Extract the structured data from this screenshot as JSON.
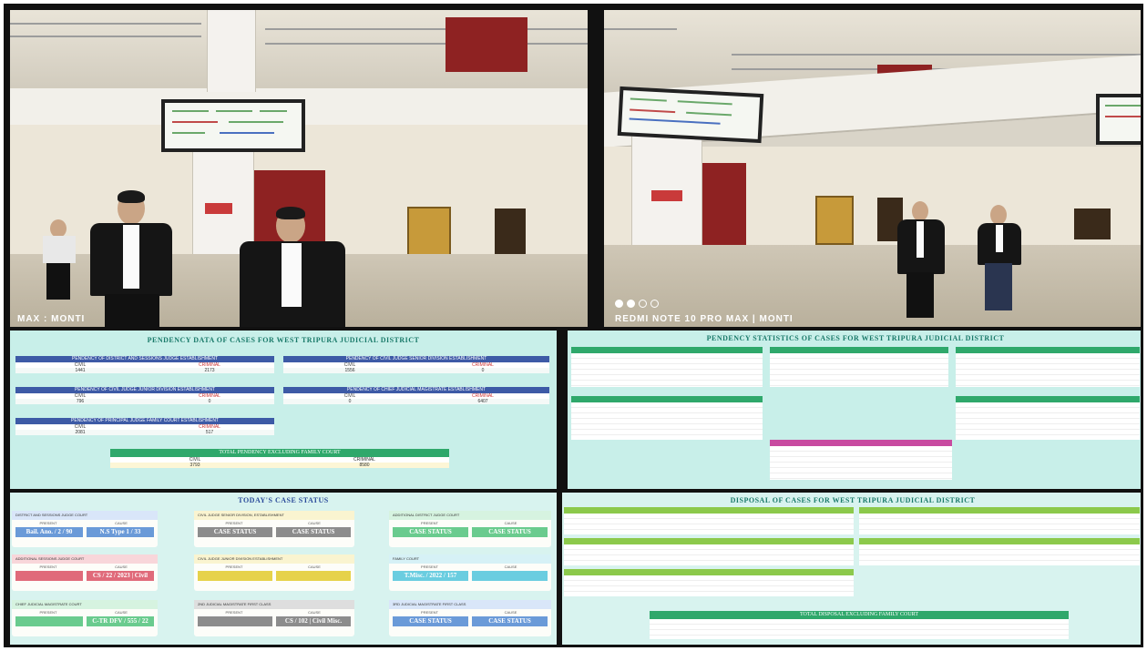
{
  "photos": {
    "left_watermark": "MAX : MONTI",
    "right_watermark": "REDMI NOTE 10 PRO MAX | MONTI"
  },
  "pendency_data": {
    "title": "PENDENCY DATA OF CASES FOR WEST TRIPURA JUDICIAL DISTRICT",
    "boxes": [
      {
        "header": "PENDENCY OF DISTRICT AND SESSIONS JUDGE ESTABLISHMENT",
        "cols": [
          "CIVIL",
          "CRIMINAL"
        ],
        "values": [
          "1441",
          "2173"
        ]
      },
      {
        "header": "PENDENCY OF CIVIL JUDGE SENIOR DIVISION ESTABLISHMENT",
        "cols": [
          "CIVIL",
          "CRIMINAL"
        ],
        "values": [
          "1556",
          "0"
        ]
      },
      {
        "header": "PENDENCY OF CIVIL JUDGE JUNIOR DIVISION ESTABLISHMENT",
        "cols": [
          "CIVIL",
          "CRIMINAL"
        ],
        "values": [
          "796",
          "0"
        ]
      },
      {
        "header": "PENDENCY OF CHIEF JUDICIAL MAGISTRATE ESTABLISHMENT",
        "cols": [
          "CIVIL",
          "CRIMINAL"
        ],
        "values": [
          "0",
          "6407"
        ]
      },
      {
        "header": "PENDENCY OF PRINCIPAL JUDGE FAMILY COURT ESTABLISHMENT",
        "cols": [
          "CIVIL",
          "CRIMINAL"
        ],
        "values": [
          "2081",
          "517"
        ]
      }
    ],
    "total_header": "TOTAL PENDENCY EXCLUDING FAMILY COURT",
    "total_cols": [
      "CIVIL",
      "CRIMINAL"
    ],
    "total_values": [
      "3793",
      "8580"
    ]
  },
  "pendency_stats": {
    "title": "PENDENCY STATISTICS OF CASES FOR WEST TRIPURA JUDICIAL DISTRICT"
  },
  "todays_status": {
    "title": "TODAY'S CASE STATUS",
    "cards": [
      {
        "header": "DISTRICT AND SESSIONS JUDGE COURT",
        "cols": [
          "PRESENT",
          "CAUSE"
        ],
        "values": [
          "Bail. Ano. / 2 / 90",
          "N.S Type 1 / 33"
        ]
      },
      {
        "header": "CIVIL JUDGE SENIOR DIVISION, ESTABLISHMENT",
        "cols": [
          "PRESENT",
          "CAUSE"
        ],
        "values": [
          "CASE STATUS",
          "CASE STATUS"
        ]
      },
      {
        "header": "ADDITIONAL DISTRICT JUDGE COURT",
        "cols": [
          "PRESENT",
          "CAUSE"
        ],
        "values": [
          "CASE STATUS",
          "CASE STATUS"
        ]
      },
      {
        "header": "ADDITIONAL SESSIONS JUDGE COURT",
        "cols": [
          "PRESENT",
          "CAUSE"
        ],
        "values": [
          "",
          "CS / 22 / 2023 | Civil"
        ]
      },
      {
        "header": "CIVIL JUDGE JUNIOR DIVISION ESTABLISHMENT",
        "cols": [
          "PRESENT",
          "CAUSE"
        ],
        "values": [
          "",
          ""
        ]
      },
      {
        "header": "FAMILY COURT",
        "cols": [
          "PRESENT",
          "CAUSE"
        ],
        "values": [
          "T.Misc. / 2022 / 157",
          ""
        ]
      },
      {
        "header": "CHIEF JUDICIAL MAGISTRATE COURT",
        "cols": [
          "PRESENT",
          "CAUSE"
        ],
        "values": [
          "",
          "C-TR DFV / 555 / 22"
        ]
      },
      {
        "header": "2ND JUDICIAL MAGISTRATE FIRST CLASS",
        "cols": [
          "PRESENT",
          "CAUSE"
        ],
        "values": [
          "",
          "CS / 102 | Civil Misc."
        ]
      },
      {
        "header": "3RD JUDICIAL MAGISTRATE FIRST CLASS",
        "cols": [
          "PRESENT",
          "CAUSE"
        ],
        "values": [
          "CASE STATUS",
          "CASE STATUS"
        ]
      }
    ]
  },
  "disposal": {
    "title": "DISPOSAL OF CASES FOR WEST TRIPURA JUDICIAL DISTRICT",
    "total_header": "TOTAL DISPOSAL EXCLUDING FAMILY COURT"
  }
}
